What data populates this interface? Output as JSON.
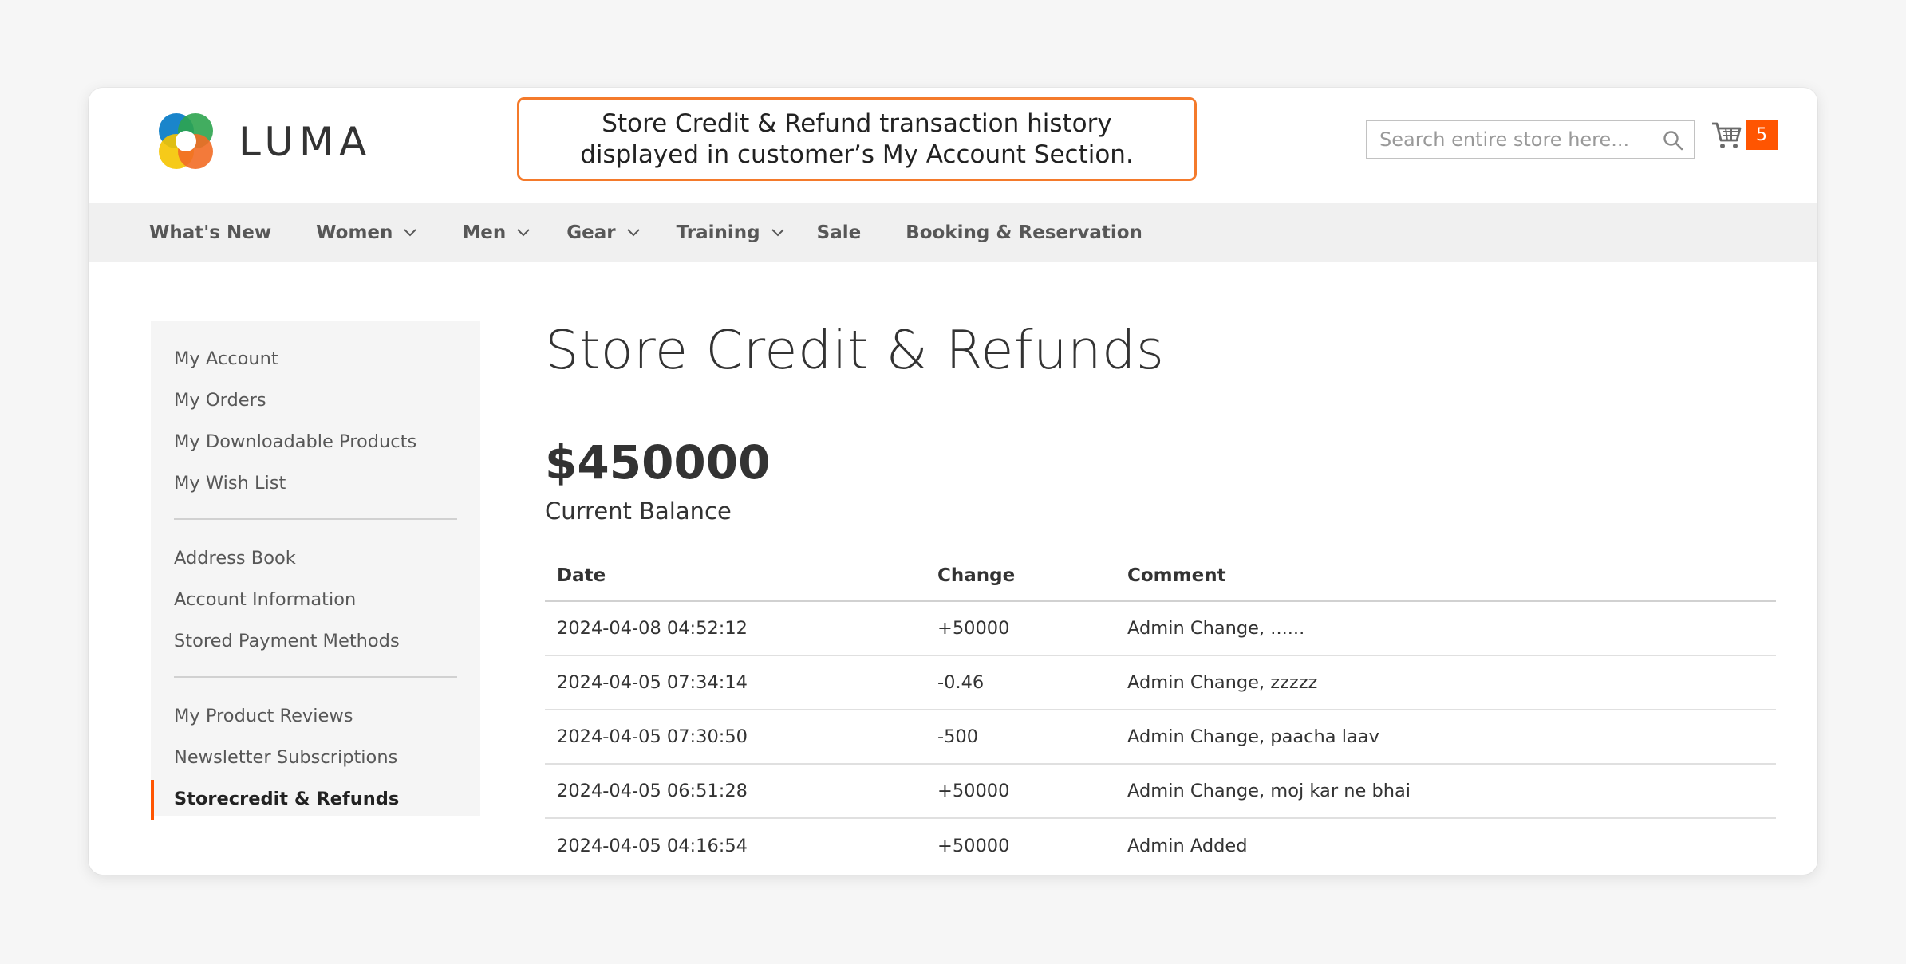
{
  "brand": {
    "name": "LUMA"
  },
  "callout": {
    "line1": "Store Credit & Refund transaction history",
    "line2": "displayed in customer’s My Account Section."
  },
  "search": {
    "placeholder": "Search entire store here..."
  },
  "cart": {
    "count": "5"
  },
  "nav": {
    "items": [
      {
        "label": "What's New",
        "has_dropdown": false
      },
      {
        "label": "Women",
        "has_dropdown": true
      },
      {
        "label": "Men",
        "has_dropdown": true
      },
      {
        "label": "Gear",
        "has_dropdown": true
      },
      {
        "label": "Training",
        "has_dropdown": true
      },
      {
        "label": "Sale",
        "has_dropdown": false
      },
      {
        "label": "Booking & Reservation",
        "has_dropdown": false
      }
    ]
  },
  "sidebar": {
    "items": [
      {
        "label": "My Account"
      },
      {
        "label": "My Orders"
      },
      {
        "label": "My Downloadable Products"
      },
      {
        "label": "My Wish List"
      },
      {
        "label": "Address Book"
      },
      {
        "label": "Account Information"
      },
      {
        "label": "Stored Payment Methods"
      },
      {
        "label": "My Product Reviews"
      },
      {
        "label": "Newsletter Subscriptions"
      },
      {
        "label": "Storecredit & Refunds",
        "active": true
      }
    ]
  },
  "main": {
    "title": "Store Credit & Refunds",
    "balance": "$450000",
    "balance_label": "Current Balance"
  },
  "table": {
    "headers": [
      "Date",
      "Change",
      "Comment"
    ],
    "rows": [
      {
        "date": "2024-04-08 04:52:12",
        "change": "+50000",
        "comment": "Admin Change, ......"
      },
      {
        "date": "2024-04-05 07:34:14",
        "change": "-0.46",
        "comment": "Admin Change, zzzzz"
      },
      {
        "date": "2024-04-05 07:30:50",
        "change": "-500",
        "comment": "Admin Change, paacha laav"
      },
      {
        "date": "2024-04-05 06:51:28",
        "change": "+50000",
        "comment": "Admin Change, moj kar ne bhai"
      },
      {
        "date": "2024-04-05 04:16:54",
        "change": "+50000",
        "comment": "Admin Added"
      }
    ]
  },
  "colors": {
    "accent": "#ff5501",
    "callout_border": "#f47a2b",
    "positive": "#1a8a1a",
    "negative": "#d32121"
  }
}
